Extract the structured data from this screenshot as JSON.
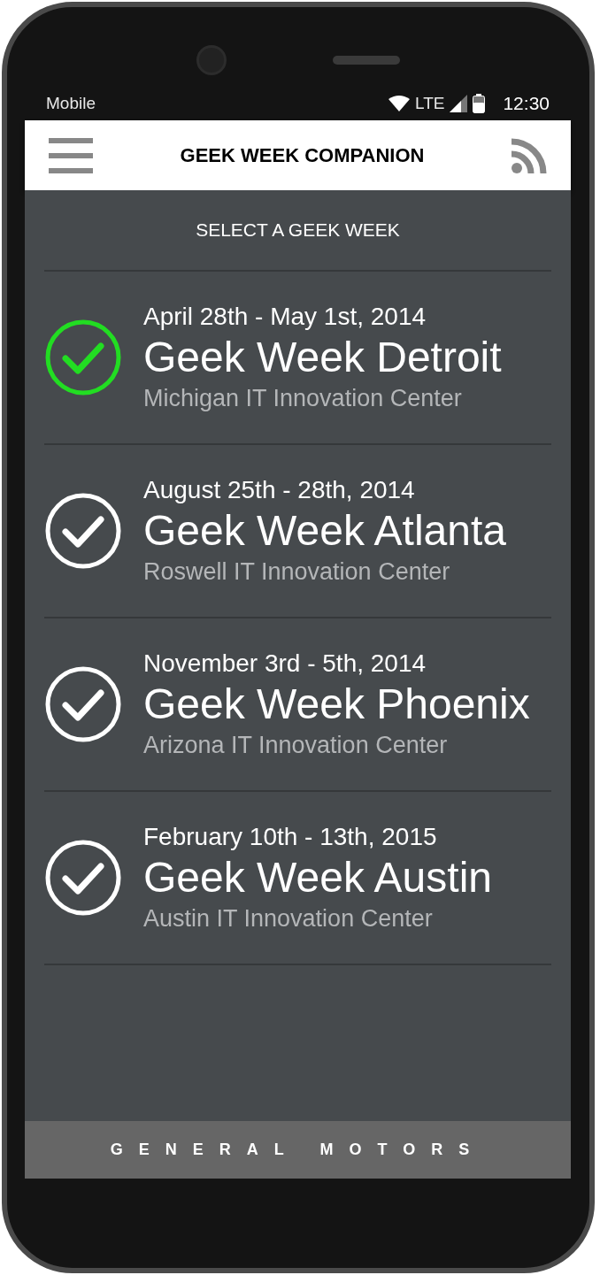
{
  "status_bar": {
    "carrier": "Mobile",
    "network": "LTE",
    "time": "12:30"
  },
  "app_bar": {
    "title": "GEEK WEEK COMPANION"
  },
  "heading": "SELECT A GEEK WEEK",
  "events": [
    {
      "dates": "April 28th - May 1st, 2014",
      "name": "Geek Week Detroit",
      "venue": "Michigan IT Innovation Center",
      "selected": true
    },
    {
      "dates": "August 25th - 28th, 2014",
      "name": "Geek Week Atlanta",
      "venue": "Roswell IT Innovation Center",
      "selected": false
    },
    {
      "dates": "November 3rd - 5th, 2014",
      "name": "Geek Week Phoenix",
      "venue": "Arizona IT Innovation Center",
      "selected": false
    },
    {
      "dates": "February 10th - 13th, 2015",
      "name": "Geek Week Austin",
      "venue": "Austin IT Innovation Center",
      "selected": false
    }
  ],
  "footer": "GENERAL MOTORS"
}
